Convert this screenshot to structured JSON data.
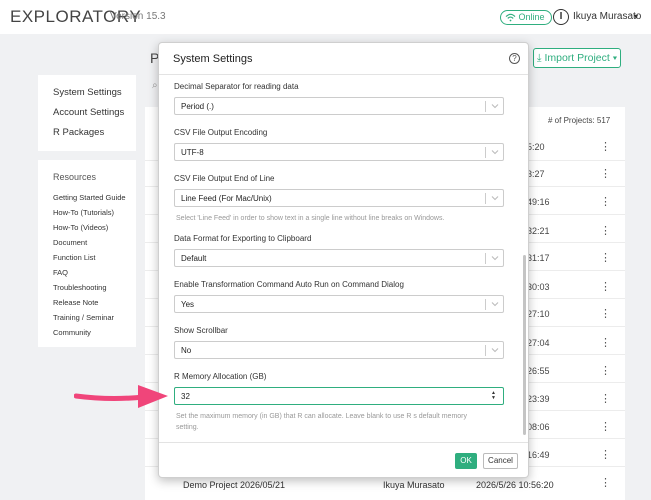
{
  "app": {
    "brand": "EXPLORATORY",
    "version": "Version 15.3",
    "online_label": "Online",
    "user_initial": "I",
    "user_name": "Ikuya Murasato",
    "caret": "▾"
  },
  "page": {
    "title_initial": "P",
    "import_label": "Import Project",
    "import_icon": "download-icon",
    "project_count": "# of Projects: 517"
  },
  "sidebar": {
    "top_items": [
      "System Settings",
      "Account Settings",
      "R Packages"
    ],
    "resources_heading": "Resources",
    "resources": [
      "Getting Started Guide",
      "How-To (Tutorials)",
      "How-To (Videos)",
      "Document",
      "Function List",
      "FAQ",
      "Troubleshooting",
      "Release Note",
      "Training / Seminar",
      "Community"
    ]
  },
  "project_rows": [
    {
      "time": "5:20"
    },
    {
      "time": "3:27"
    },
    {
      "time": "49:16"
    },
    {
      "time": "32:21"
    },
    {
      "time": "31:17"
    },
    {
      "time": "30:03"
    },
    {
      "time": "27:10"
    },
    {
      "time": "27:04"
    },
    {
      "time": "26:55"
    },
    {
      "time": "23:39"
    },
    {
      "time": "08:06"
    },
    {
      "time": "16:49"
    }
  ],
  "demo_row": {
    "name": "Demo Project 2026/05/21",
    "owner": "Ikuya Murasato",
    "date": "2026/5/26 10:56:20"
  },
  "modal": {
    "title": "System Settings",
    "help": "?",
    "fields": [
      {
        "label": "Decimal Separator for reading data",
        "value": "Period (.)"
      },
      {
        "label": "CSV File Output Encoding",
        "value": "UTF-8"
      },
      {
        "label": "CSV File Output End of Line",
        "value": "Line Feed (For Mac/Unix)"
      },
      {
        "label": "Data Format for Exporting to Clipboard",
        "value": "Default"
      },
      {
        "label": "Enable Transformation Command Auto Run on Command Dialog",
        "value": "Yes"
      },
      {
        "label": "Show Scrollbar",
        "value": "No"
      }
    ],
    "eol_help": "Select 'Line Feed' in order to show text in a single line without line breaks on Windows.",
    "memory": {
      "label": "R Memory Allocation (GB)",
      "value": "32",
      "help_line1": "Set the maximum memory (in GB) that R can allocate. Leave blank to use R s default memory",
      "help_line2": "setting."
    },
    "ok_label": "OK",
    "cancel_label": "Cancel"
  },
  "colors": {
    "accent": "#2fae7f",
    "arrow": "#f0457a"
  }
}
